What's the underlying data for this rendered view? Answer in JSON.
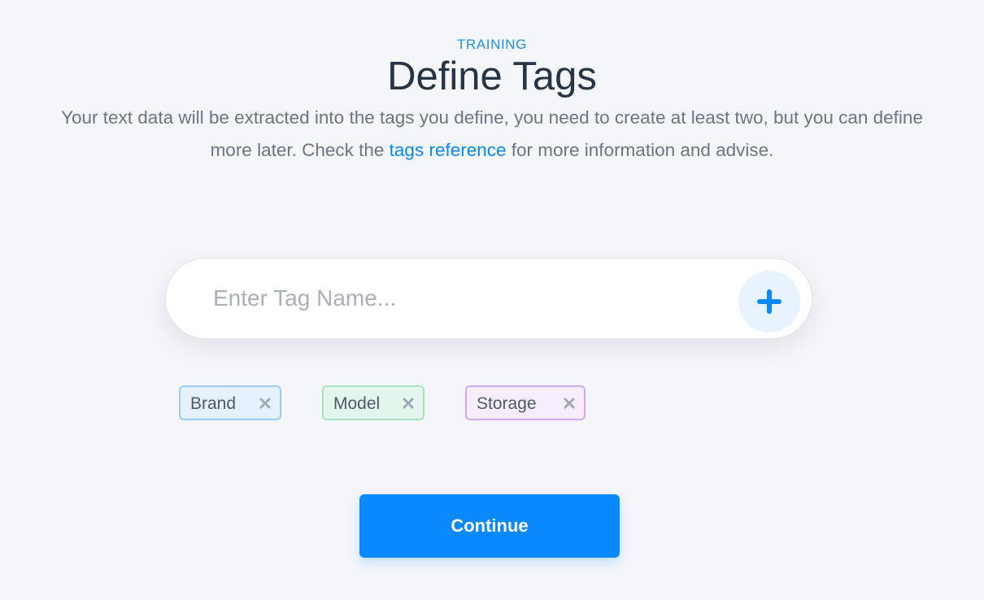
{
  "header": {
    "eyebrow": "TRAINING",
    "title": "Define Tags",
    "description_before_link": "Your text data will be extracted into the tags you define, you need to create at least two, but you can define more later. Check the ",
    "link_text": "tags reference",
    "description_after_link": " for more information and advise."
  },
  "tag_input": {
    "placeholder": "Enter Tag Name...",
    "value": "",
    "add_icon": "plus-icon"
  },
  "tags": [
    {
      "label": "Brand",
      "color": "#e3f2fd",
      "border": "#9dcdf5",
      "remove_icon": "close-icon"
    },
    {
      "label": "Model",
      "color": "#e4f7ec",
      "border": "#a8e3bf",
      "remove_icon": "close-icon"
    },
    {
      "label": "Storage",
      "color": "#f6eefc",
      "border": "#cfaaf1",
      "remove_icon": "close-icon"
    }
  ],
  "actions": {
    "continue_label": "Continue"
  },
  "colors": {
    "accent": "#0a89ff",
    "link": "#0a87f0",
    "background": "#f5f6fa"
  }
}
